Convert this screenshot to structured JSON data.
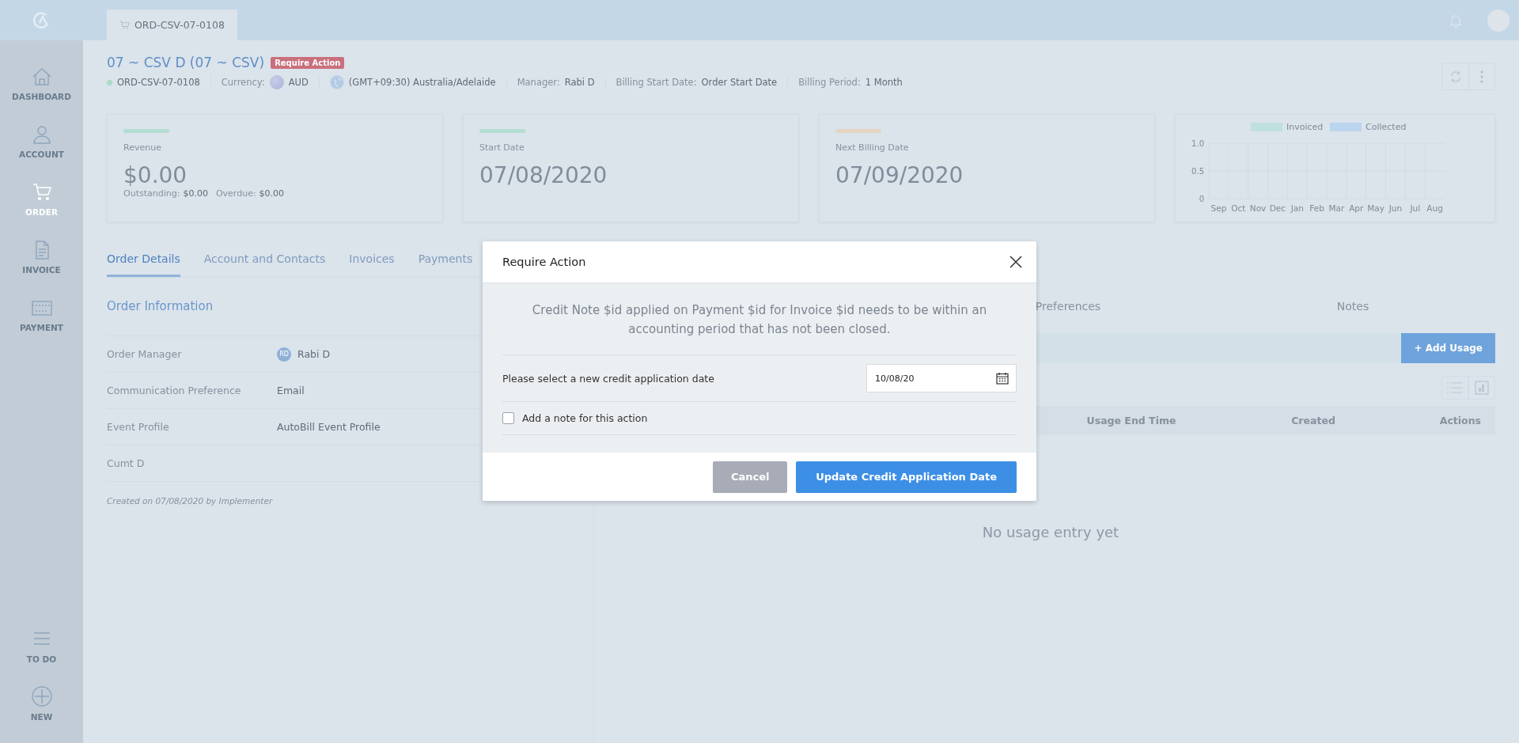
{
  "header": {
    "tab": {
      "label": "ORD-CSV-07-0108",
      "selected": true
    }
  },
  "sidebar": {
    "items": [
      {
        "label": "DASHBOARD",
        "selected": false
      },
      {
        "label": "ACCOUNT",
        "selected": false
      },
      {
        "label": "ORDER",
        "selected": true
      },
      {
        "label": "INVOICE",
        "selected": false
      },
      {
        "label": "PAYMENT",
        "selected": false
      }
    ],
    "bottom_items": [
      {
        "label": "TO DO"
      },
      {
        "label": "NEW"
      }
    ]
  },
  "order": {
    "title": "07 ~ CSV D (07 ~ CSV)",
    "badge": "Require Action",
    "meta": [
      {
        "kind": "status",
        "value": "ORD-CSV-07-0108"
      },
      {
        "kind": "currency",
        "label": "Currency:",
        "value": "AUD"
      },
      {
        "kind": "timezone",
        "value": "(GMT+09:30) Australia/Adelaide"
      },
      {
        "kind": "field",
        "label": "Manager:",
        "value": "Rabi D"
      },
      {
        "kind": "field",
        "label": "Billing Start Date:",
        "value": "Order Start Date"
      },
      {
        "kind": "field",
        "label": "Billing Period:",
        "value": "1 Month"
      }
    ]
  },
  "cards": [
    {
      "label": "Revenue",
      "color": "#b4ddd2",
      "value": "$0.00",
      "sub": [
        {
          "label": "Outstanding:",
          "value": "$0.00"
        },
        {
          "label": "Overdue:",
          "value": "$0.00"
        }
      ]
    },
    {
      "label": "Start Date",
      "color": "#b4ddd2",
      "value": "07/08/2020"
    },
    {
      "label": "Next Billing Date",
      "color": "#e3d5c0",
      "value": "07/09/2020"
    }
  ],
  "chart_data": {
    "type": "bar",
    "categories": [
      "Sep",
      "Oct",
      "Nov",
      "Dec",
      "Jan",
      "Feb",
      "Mar",
      "Apr",
      "May",
      "Jun",
      "Jul",
      "Aug"
    ],
    "series": [
      {
        "name": "Invoiced",
        "color": "#bfe0dc",
        "values": [
          0,
          0,
          0,
          0,
          0,
          0,
          0,
          0,
          0,
          0,
          0,
          0
        ]
      },
      {
        "name": "Collected",
        "color": "#bcd5ef",
        "values": [
          0,
          0,
          0,
          0,
          0,
          0,
          0,
          0,
          0,
          0,
          0,
          0
        ]
      }
    ],
    "ylim": [
      0,
      1
    ],
    "yticks": [
      0,
      0.5,
      {
        "value": 1,
        "label": "1.0"
      }
    ]
  },
  "tabs": [
    {
      "label": "Order Details",
      "selected": true
    },
    {
      "label": "Account and Contacts",
      "selected": false
    },
    {
      "label": "Invoices",
      "selected": false
    },
    {
      "label": "Payments",
      "selected": false
    }
  ],
  "order_information": {
    "heading": "Order Information",
    "rows": [
      {
        "label": "Order Manager",
        "value": "Rabi D",
        "avatar": "RD"
      },
      {
        "label": "Communication Preference",
        "value": "Email"
      },
      {
        "label": "Event Profile",
        "value": "AutoBill Event Profile"
      },
      {
        "label": "Cumt D"
      }
    ],
    "footer": "Created on 07/08/2020 by Implementer"
  },
  "usage_panel": {
    "tabs": [
      "Preferences",
      "Notes"
    ],
    "add_button": "+ Add Usage",
    "columns": [
      "Usage End Time",
      "Created",
      "Actions"
    ],
    "empty_message": "No usage entry yet"
  },
  "modal": {
    "title": "Require Action",
    "message": "Credit Note $id applied on Payment $id for Invoice $id needs to be within an accounting period that has not been closed.",
    "date_label": "Please select a new credit application date",
    "date_value": "10/08/20",
    "note_checkbox": {
      "label": "Add a note for this action",
      "checked": false
    },
    "cancel": "Cancel",
    "confirm": "Update Credit Application Date"
  }
}
